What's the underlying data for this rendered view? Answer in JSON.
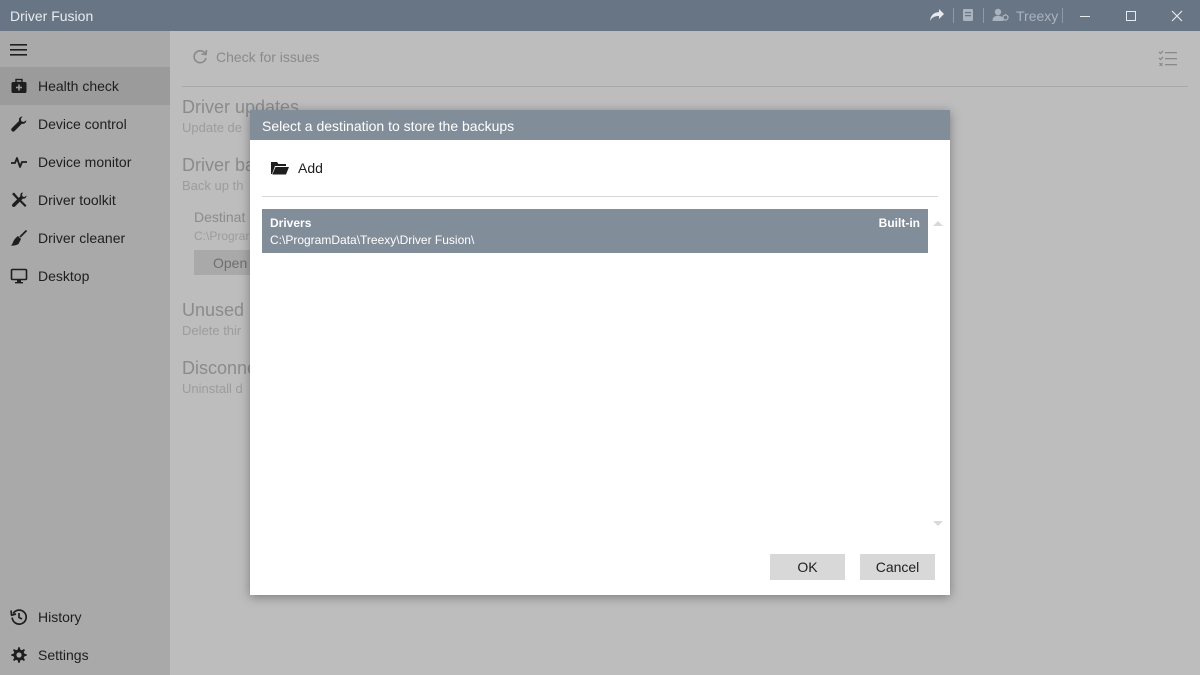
{
  "window": {
    "title": "Driver Fusion",
    "user_label": "Treexy"
  },
  "sidebar": {
    "items": [
      {
        "label": "Health check",
        "icon": "first-aid-kit-icon"
      },
      {
        "label": "Device control",
        "icon": "wrench-icon"
      },
      {
        "label": "Device monitor",
        "icon": "pulse-icon"
      },
      {
        "label": "Driver toolkit",
        "icon": "tools-icon"
      },
      {
        "label": "Driver cleaner",
        "icon": "broom-icon"
      },
      {
        "label": "Desktop",
        "icon": "monitor-icon"
      }
    ],
    "bottom_items": [
      {
        "label": "History",
        "icon": "history-icon"
      },
      {
        "label": "Settings",
        "icon": "gear-icon"
      }
    ]
  },
  "main": {
    "check_issues_label": "Check for issues",
    "sections": [
      {
        "title": "Driver updates",
        "subtitle": "Update de"
      },
      {
        "title": "Driver ba",
        "subtitle": "Back up th"
      },
      {
        "title": "Unused",
        "subtitle": "Delete thir"
      },
      {
        "title": "Disconne",
        "subtitle": "Uninstall d"
      }
    ],
    "destination": {
      "label": "Destinat",
      "path": "C:\\Prograr",
      "open_label": "Open"
    }
  },
  "dialog": {
    "title": "Select a destination to store the backups",
    "add_label": "Add",
    "items": [
      {
        "name": "Drivers",
        "path": "C:\\ProgramData\\Treexy\\Driver Fusion\\",
        "badge": "Built-in"
      }
    ],
    "ok_label": "OK",
    "cancel_label": "Cancel"
  },
  "colors": {
    "titlebar": "#687585",
    "dialog_header": "#828d9a",
    "selected_item": "#828d9a"
  }
}
